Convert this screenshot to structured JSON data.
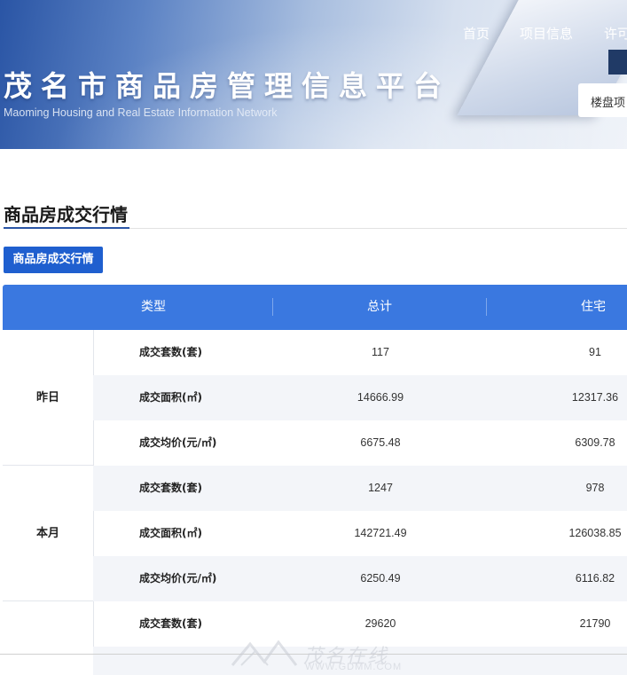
{
  "header": {
    "nav": [
      "首页",
      "项目信息",
      "许可"
    ],
    "title": "茂名市商品房管理信息平台",
    "subtitle": "Maoming Housing and Real Estate Information Network",
    "search_label": "楼盘项"
  },
  "section": {
    "title": "商品房成交行情",
    "tab_label": "商品房成交行情"
  },
  "table": {
    "headers": [
      "类型",
      "总计",
      "住宅"
    ],
    "groups": [
      {
        "name": "昨日",
        "rows": [
          {
            "label": "成交套数(套)",
            "total": "117",
            "residential": "91"
          },
          {
            "label": "成交面积(㎡)",
            "total": "14666.99",
            "residential": "12317.36"
          },
          {
            "label": "成交均价(元/㎡)",
            "total": "6675.48",
            "residential": "6309.78"
          }
        ]
      },
      {
        "name": "本月",
        "rows": [
          {
            "label": "成交套数(套)",
            "total": "1247",
            "residential": "978"
          },
          {
            "label": "成交面积(㎡)",
            "total": "142721.49",
            "residential": "126038.85"
          },
          {
            "label": "成交均价(元/㎡)",
            "total": "6250.49",
            "residential": "6116.82"
          }
        ]
      },
      {
        "name": "",
        "rows": [
          {
            "label": "成交套数(套)",
            "total": "29620",
            "residential": "21790"
          }
        ]
      }
    ]
  },
  "watermark": {
    "text": "茂名在线",
    "url": "WWW.GDMM.COM"
  },
  "colors": {
    "accent": "#1f5fcf",
    "table_header": "#3a78e0",
    "row_alt": "#f3f5f9"
  }
}
